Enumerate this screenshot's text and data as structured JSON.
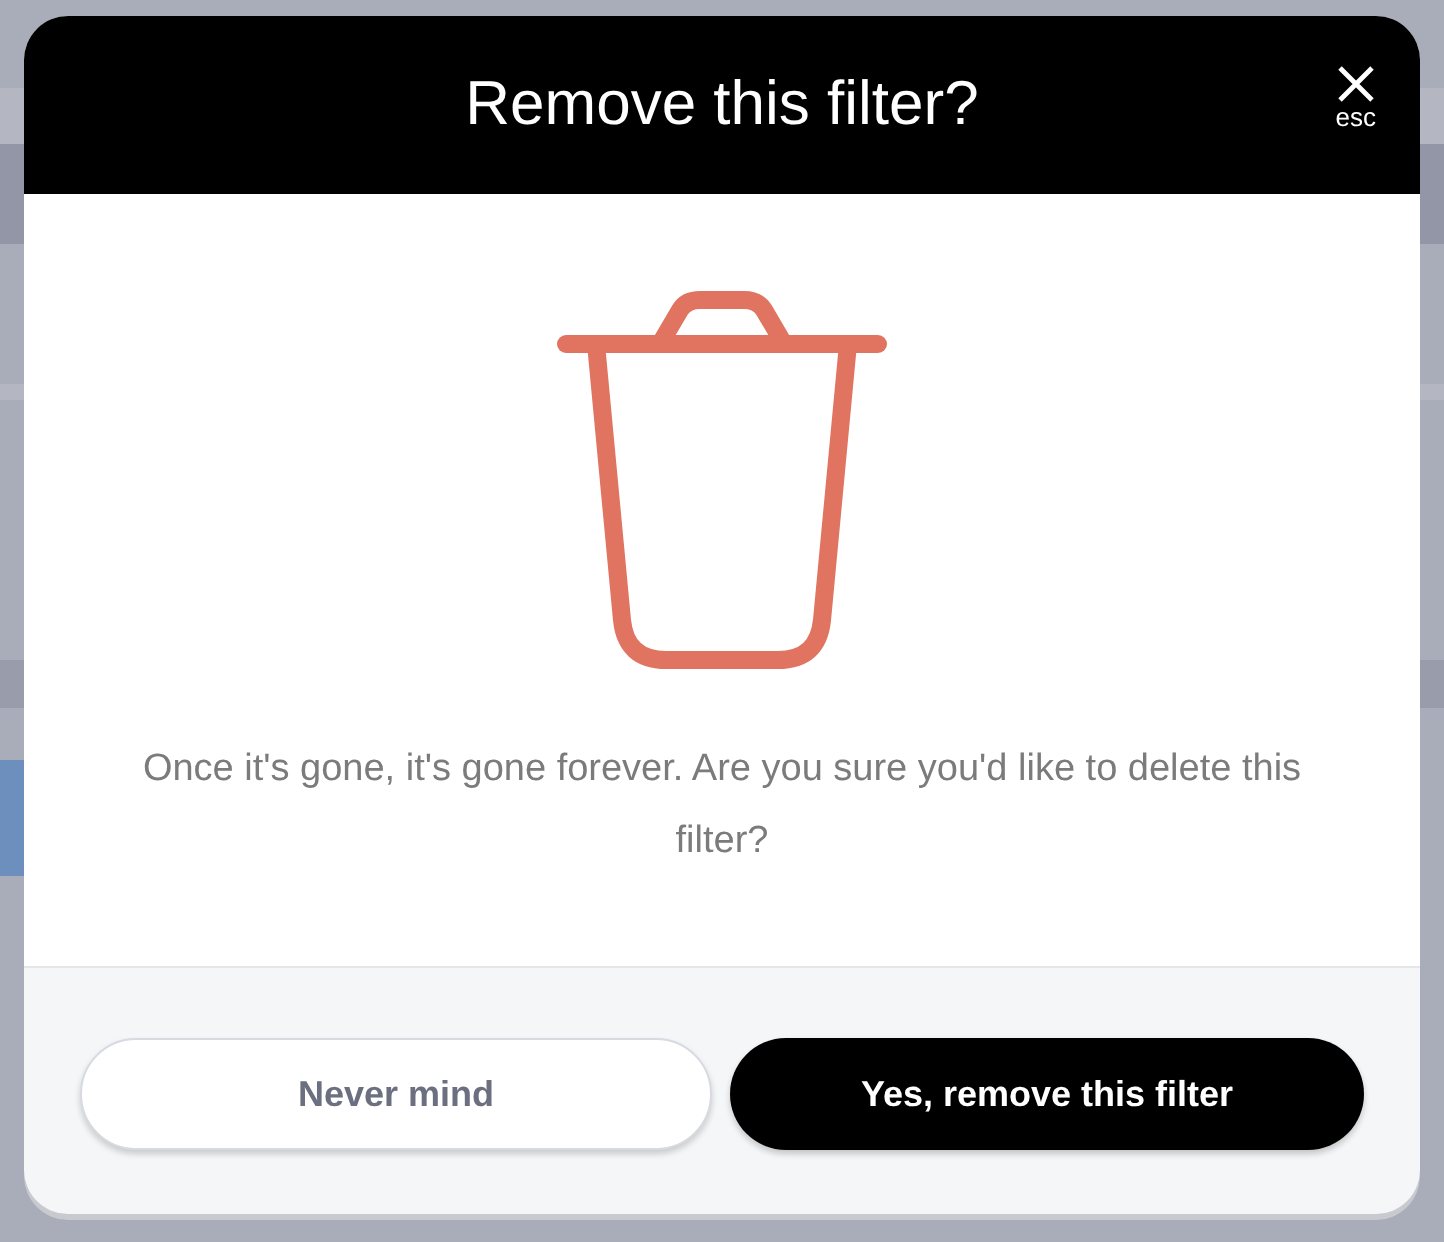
{
  "dialog": {
    "title": "Remove this filter?",
    "close_hint": "esc",
    "message": "Once it's gone, it's gone forever. Are you sure you'd like to delete this filter?",
    "buttons": [
      {
        "label": "Never mind",
        "kind": "secondary"
      },
      {
        "label": "Yes, remove this filter",
        "kind": "primary"
      }
    ]
  }
}
